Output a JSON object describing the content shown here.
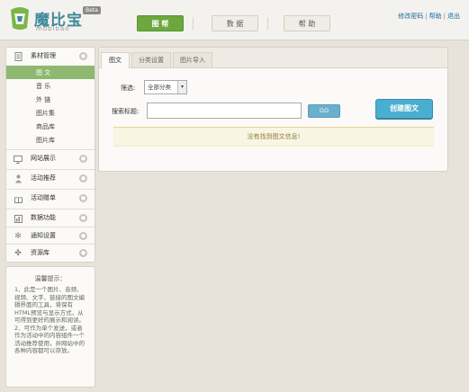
{
  "header": {
    "logo_name": "魔比宝",
    "logo_sub": "mobibao",
    "beta": "Beta",
    "nav": [
      {
        "label": "图 帮",
        "active": true
      },
      {
        "label": "数 据",
        "active": false
      },
      {
        "label": "帮 助",
        "active": false
      }
    ],
    "links": [
      "修改密码",
      "帮助",
      "退出"
    ]
  },
  "sidebar": {
    "items": [
      {
        "label": "素材管理",
        "icon": "document-icon"
      },
      {
        "label": "网站展示",
        "icon": "monitor-icon"
      },
      {
        "label": "活动推荐",
        "icon": "person-icon"
      },
      {
        "label": "活动赠单",
        "icon": "gift-icon"
      },
      {
        "label": "数据功能",
        "icon": "chart-icon"
      },
      {
        "label": "通知设置",
        "icon": "gear-icon"
      },
      {
        "label": "资源库",
        "icon": "puzzle-icon"
      }
    ],
    "sub_items": [
      "图 文",
      "音 乐",
      "外 链",
      "图片集",
      "商品库",
      "图片库"
    ]
  },
  "tips": {
    "title": "温馨提示：",
    "text": "1、此是一个图片、音频、视频、文字、链接的图文编辑界面的工具，将保有HTML预览与显示方式，从可得到更好的展示和阅读。\n2、可作为单个发送，或者作为活动中的内容组件一个活动推荐使用，并网站中的各种内容都可以存放。"
  },
  "main": {
    "tabs": [
      "图文",
      "分类设置",
      "图片导入"
    ],
    "filter_label": "筛选:",
    "filter_value": "全部分类",
    "search_label": "搜索标题:",
    "search_value": "",
    "go_label": "GO",
    "create_label": "创建图文",
    "empty_text": "没有找到图文信息!"
  },
  "colors": {
    "accent_green": "#6ba83d",
    "create_blue": "#4aaed0",
    "link_blue": "#1a6aa0"
  }
}
